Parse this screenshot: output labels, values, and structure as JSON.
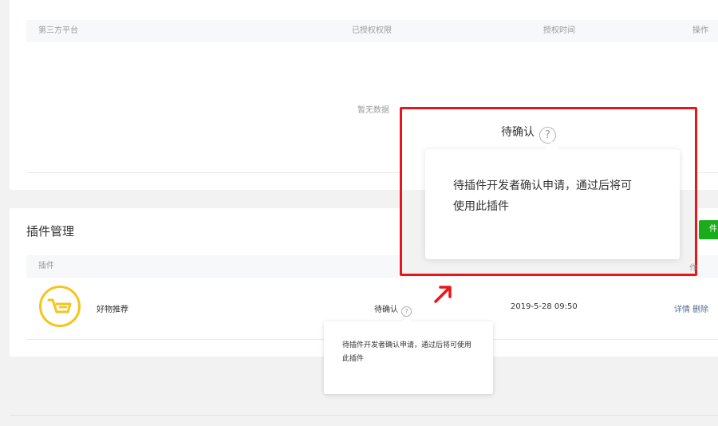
{
  "authorized_table": {
    "columns": [
      "第三方平台",
      "已授权权限",
      "授权时间",
      "操作"
    ],
    "empty_text": "暂无数据"
  },
  "plugin_section": {
    "title": "插件管理",
    "add_button_label": "件",
    "columns": [
      "插件"
    ],
    "rows": [
      {
        "name": "好物推荐",
        "status": "待确认",
        "date": "2019-5-28 09:50",
        "actions": [
          "详情",
          "删除"
        ],
        "logo_icon": "shopping-cart-icon"
      }
    ]
  },
  "tooltip": {
    "text": "待插件开发者确认申请，通过后将可使用此插件"
  },
  "zoom_callout": {
    "status": "待确认",
    "tooltip_line1": "待插件开发者确认申请，通过后将可",
    "tooltip_line2": "使用此插件",
    "right_fragment": "作"
  },
  "colors": {
    "accent_green": "#1aad19",
    "link": "#576b95",
    "highlight": "#e8151b",
    "logo_yellow": "#f5c518"
  }
}
